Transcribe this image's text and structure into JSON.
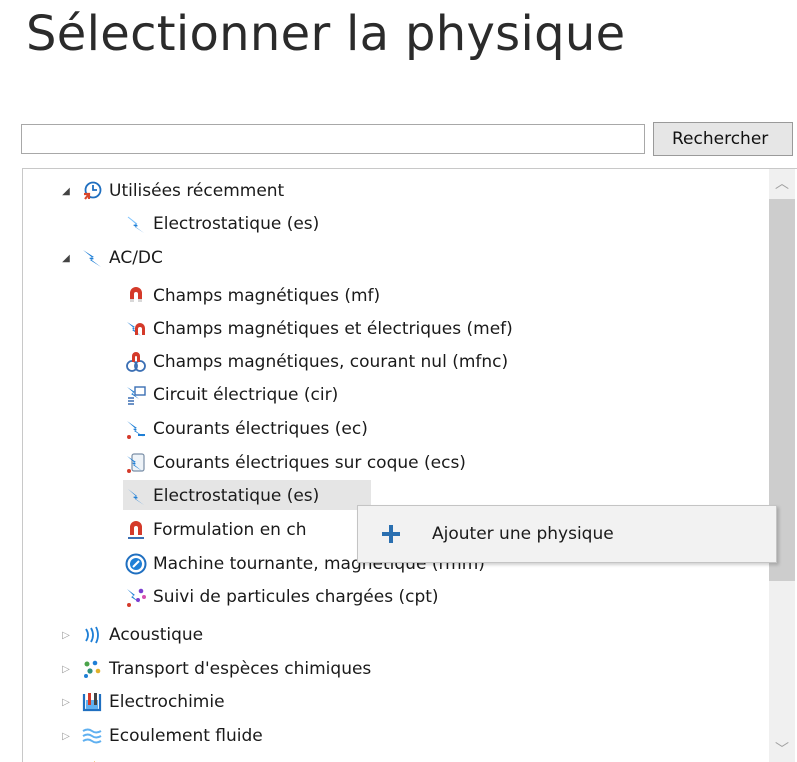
{
  "page": {
    "title": "Sélectionner la physique"
  },
  "search": {
    "value": "",
    "placeholder": "",
    "button_label": "Rechercher"
  },
  "tree": {
    "recent": {
      "label": "Utilisées récemment",
      "icon": "clock-icon",
      "expanded": true
    },
    "recent_items": [
      {
        "label": "Electrostatique (es)",
        "icon": "electrostatics-icon"
      }
    ],
    "acdc": {
      "label": "AC/DC",
      "icon": "lightning-icon",
      "expanded": true
    },
    "acdc_items": [
      {
        "label": "Champs magnétiques (mf)",
        "icon": "magnet-icon"
      },
      {
        "label": "Champs magnétiques et électriques (mef)",
        "icon": "magnet-lightning-icon"
      },
      {
        "label": "Champs magnétiques, courant nul (mfnc)",
        "icon": "magnet-ring-icon"
      },
      {
        "label": "Circuit électrique (cir)",
        "icon": "circuit-icon"
      },
      {
        "label": "Courants électriques (ec)",
        "icon": "current-icon"
      },
      {
        "label": "Courants électriques sur coque (ecs)",
        "icon": "shell-current-icon"
      },
      {
        "label": "Electrostatique (es)",
        "icon": "electrostatics-icon",
        "selected": true
      },
      {
        "label": "Formulation en ch",
        "icon": "magnet-formulation-icon"
      },
      {
        "label": "Machine tournante, magnétique (rmm)",
        "icon": "rotating-machine-icon"
      },
      {
        "label": "Suivi de particules chargées (cpt)",
        "icon": "particles-icon"
      }
    ],
    "categories": [
      {
        "label": "Acoustique",
        "icon": "acoustics-icon"
      },
      {
        "label": "Transport d'espèces chimiques",
        "icon": "chemical-species-icon"
      },
      {
        "label": "Electrochimie",
        "icon": "electrochemistry-icon"
      },
      {
        "label": "Ecoulement fluide",
        "icon": "fluid-flow-icon"
      }
    ]
  },
  "context_menu": {
    "add_label": "Ajouter une physique",
    "icon": "plus-icon"
  },
  "colors": {
    "accent_blue": "#1f7fd6",
    "magnet_red": "#d43a2a",
    "plus_blue": "#2a6fb0",
    "selection": "#e5e5e5"
  }
}
